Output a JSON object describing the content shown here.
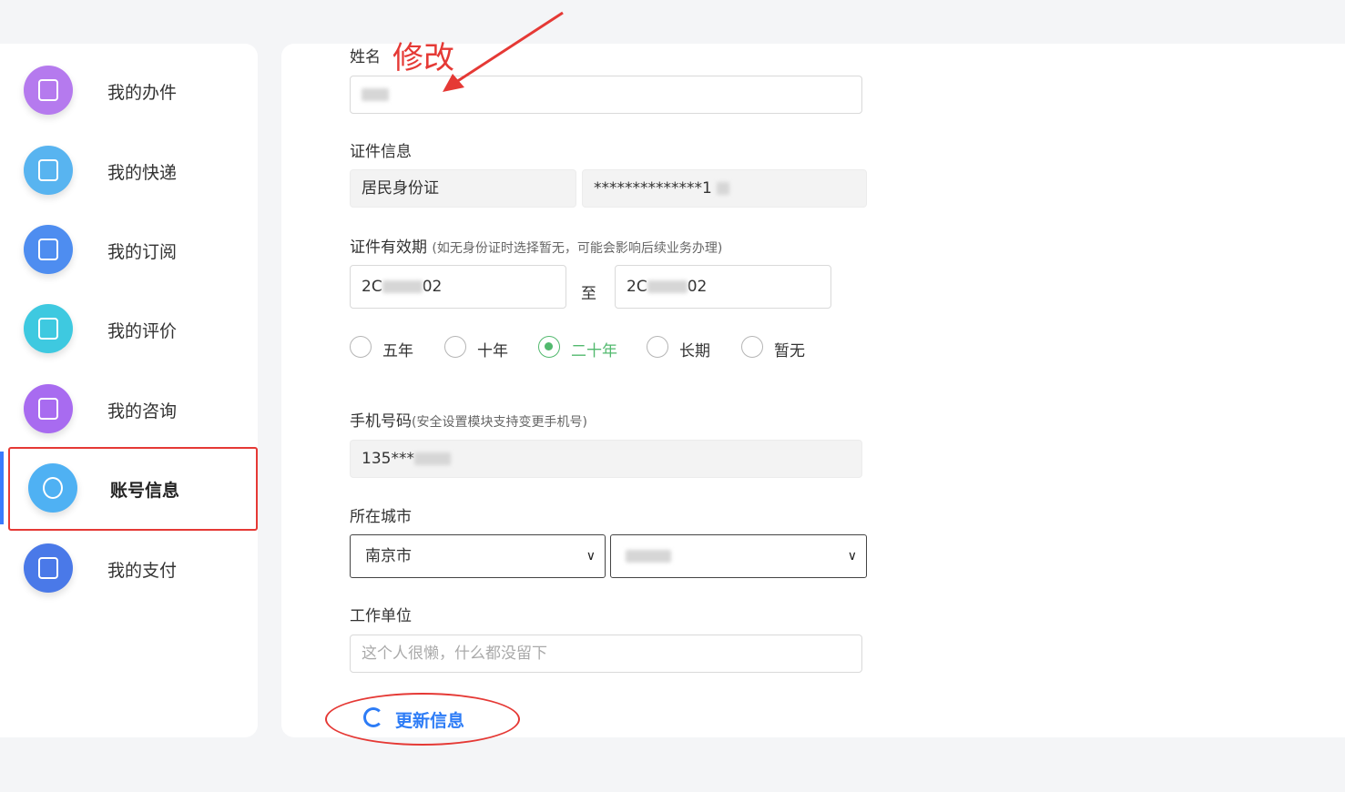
{
  "sidebar": {
    "items": [
      {
        "label": "我的办件",
        "icon": "document-user-icon",
        "color": "#b57aee"
      },
      {
        "label": "我的快递",
        "icon": "package-icon",
        "color": "#58b4f0"
      },
      {
        "label": "我的订阅",
        "icon": "calendar-icon",
        "color": "#4e8df0"
      },
      {
        "label": "我的评价",
        "icon": "chat-icon",
        "color": "#3ec9e0"
      },
      {
        "label": "我的咨询",
        "icon": "headset-user-icon",
        "color": "#a86bf0"
      },
      {
        "label": "账号信息",
        "icon": "user-icon",
        "color": "#4fb1f3",
        "active": true
      },
      {
        "label": "我的支付",
        "icon": "money-bag-icon",
        "color": "#4a79e8"
      }
    ]
  },
  "annotation": {
    "text": "修改"
  },
  "form": {
    "name": {
      "label": "姓名"
    },
    "id_info": {
      "label": "证件信息",
      "type_value": "居民身份证",
      "number_value": "**************1"
    },
    "validity": {
      "label": "证件有效期",
      "hint": "(如无身份证时选择暂无，可能会影响后续业务办理)",
      "start_prefix": "2C",
      "start_suffix": "02",
      "to": "至",
      "end_prefix": "2C",
      "end_suffix": "02"
    },
    "options": [
      {
        "label": "五年"
      },
      {
        "label": "十年"
      },
      {
        "label": "二十年",
        "selected": true
      },
      {
        "label": "长期"
      },
      {
        "label": "暂无"
      }
    ],
    "phone": {
      "label": "手机号码",
      "hint": "(安全设置模块支持变更手机号)",
      "value": "135***"
    },
    "city": {
      "label": "所在城市",
      "city_value": "南京市"
    },
    "work": {
      "label": "工作单位",
      "placeholder": "这个人很懒，什么都没留下"
    },
    "update_button": "更新信息"
  },
  "colors": {
    "accent": "#2d7cf6",
    "selected": "#52b96e",
    "annotation": "#e53935"
  }
}
